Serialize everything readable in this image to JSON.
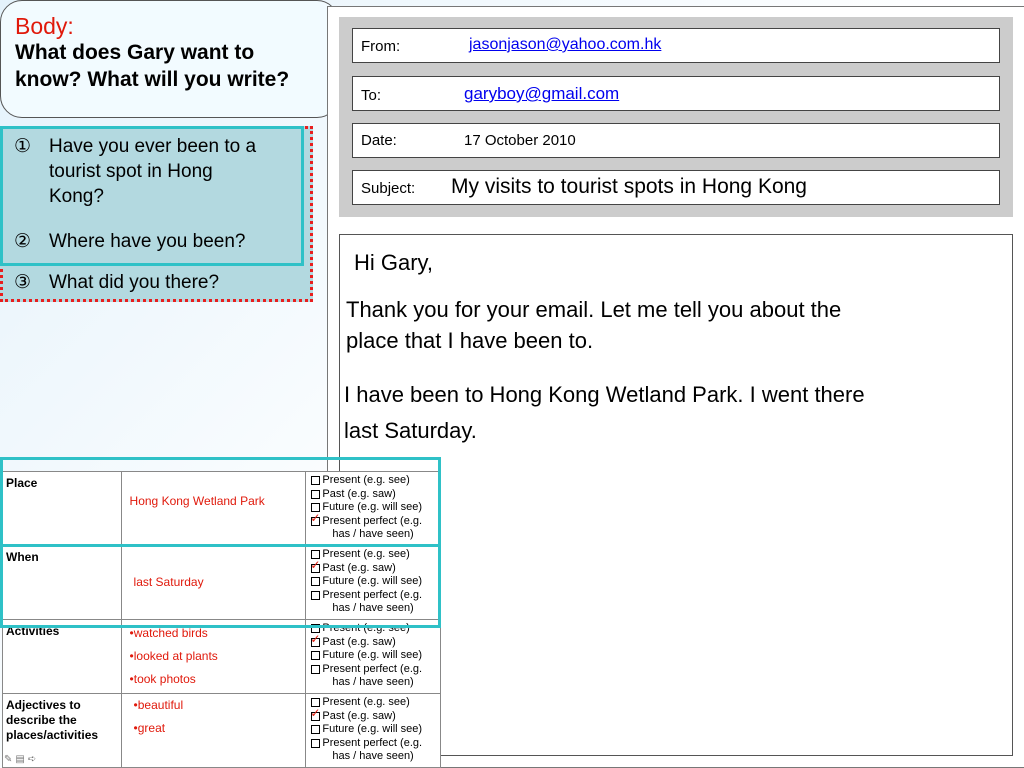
{
  "callout": {
    "heading": "Body:",
    "question_line1": "What does Gary want to",
    "question_line2": "know? What will you write?"
  },
  "questions": [
    {
      "num": "①",
      "lines": [
        "Have you ever been to a",
        "tourist spot in Hong",
        "Kong?"
      ]
    },
    {
      "num": "②",
      "lines": [
        "Where have you been?"
      ]
    },
    {
      "num": "③",
      "lines": [
        "What did you there?"
      ]
    }
  ],
  "email": {
    "from_label": "From:",
    "from_value": "jasonjason@yahoo.com.hk",
    "to_label": "To:",
    "to_value": "garyboy@gmail.com",
    "date_label": "Date:",
    "date_value": "17 October 2010",
    "subject_label": "Subject:",
    "subject_value": "My visits to tourist spots in Hong Kong",
    "body": {
      "greeting": "Hi Gary,",
      "para1_line1": "Thank you for your email. Let me tell you about the",
      "para1_line2": "place that I have been to.",
      "para2_line1": "I have been to Hong Kong Wetland Park.   I went there",
      "para2_line2": "last Saturday."
    }
  },
  "planning_table": {
    "tense_options": [
      "Present (e.g. see)",
      "Past (e.g. saw)",
      "Future (e.g. will see)",
      "Present perfect (e.g.",
      "has / have seen)"
    ],
    "rows": [
      {
        "label": "Place",
        "answers": [
          "Hong Kong Wetland Park"
        ],
        "checked": "Present perfect"
      },
      {
        "label": "When",
        "answers": [
          "last Saturday"
        ],
        "checked": "Past"
      },
      {
        "label": "Activities",
        "answers": [
          "•watched birds",
          "•looked at plants",
          "•took photos"
        ],
        "checked": "Past"
      },
      {
        "label": "Adjectives to describe the places/activities",
        "answers": [
          "•beautiful",
          "•great"
        ],
        "checked": "Past"
      }
    ]
  },
  "colors": {
    "accent_red": "#e0190b",
    "highlight_teal": "#2fc1c7",
    "question_bg": "#b3d9e0",
    "link_blue": "#0000ee"
  }
}
